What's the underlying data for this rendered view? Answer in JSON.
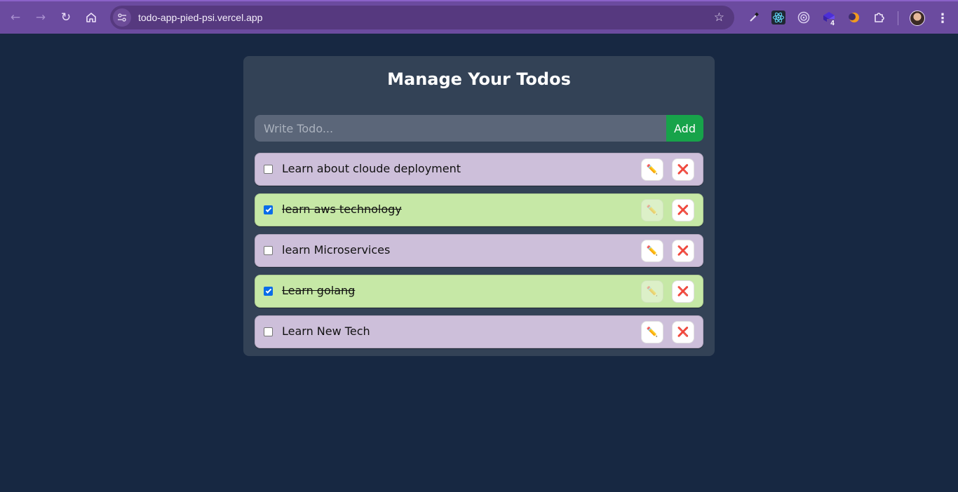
{
  "browser": {
    "url": "todo-app-pied-psi.vercel.app",
    "extension_badge": "4",
    "icons": [
      "back-arrow-icon",
      "forward-arrow-icon",
      "reload-icon",
      "home-icon",
      "site-info-icon",
      "bookmark-star-icon",
      "color-picker-icon",
      "react-devtools-icon",
      "target-icon",
      "extension-cube-icon",
      "orange-moon-icon",
      "puzzle-piece-icon",
      "profile-avatar",
      "menu-dots-icon"
    ]
  },
  "app": {
    "title": "Manage Your Todos",
    "input_placeholder": "Write Todo...",
    "input_value": "",
    "add_label": "Add",
    "edit_icon": "✏️",
    "delete_icon": "❌",
    "colors": {
      "page_bg": "#172842",
      "card_bg": "#334256",
      "todo_pending": "#cdbfda",
      "todo_done": "#c6e8a6",
      "add_button": "#17a34a"
    }
  },
  "todos": [
    {
      "text": "Learn about cloude deployment",
      "completed": false
    },
    {
      "text": "learn aws technology",
      "completed": true
    },
    {
      "text": "learn Microservices",
      "completed": false
    },
    {
      "text": "Learn golang",
      "completed": true
    },
    {
      "text": "Learn New Tech",
      "completed": false
    }
  ]
}
